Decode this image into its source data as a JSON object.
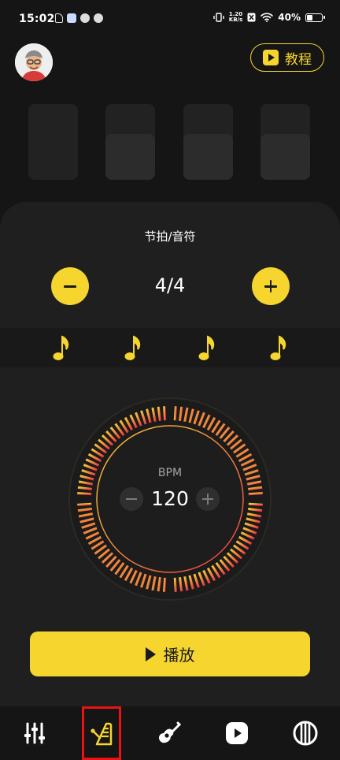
{
  "status_bar": {
    "time": "15:02",
    "net_speed_value": "1.20",
    "net_speed_unit": "KB/s",
    "battery": "40%",
    "battery_level": 0.4
  },
  "header": {
    "avatar_icon": "avatar-icon",
    "tutorial_label": "教程"
  },
  "beat_indicators": {
    "count": 4
  },
  "time_signature": {
    "title": "节拍/音符",
    "value": "4/4",
    "notes": [
      "eighth-note-icon",
      "eighth-note-icon",
      "eighth-note-icon",
      "eighth-note-icon"
    ]
  },
  "tempo": {
    "label": "BPM",
    "value": "120",
    "gradient_colors": [
      "#f5c73a",
      "#f19a3a",
      "#ee6a3f",
      "#e8343f"
    ]
  },
  "play": {
    "label": "播放"
  },
  "bottom_nav": {
    "active_index": 1,
    "items": [
      "mixer-icon",
      "metronome-icon",
      "guitar-icon",
      "play-icon",
      "tuner-icon"
    ]
  },
  "colors": {
    "accent": "#f5d52e",
    "background": "#151515",
    "panel": "#1f1f1f",
    "active_outline": "#ee1111"
  }
}
